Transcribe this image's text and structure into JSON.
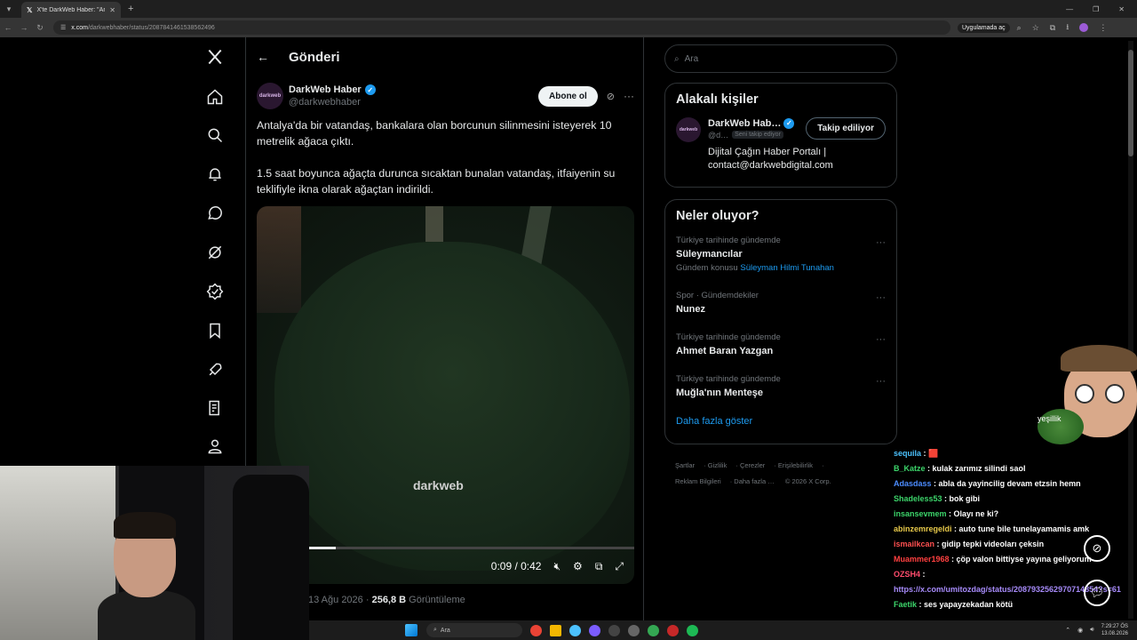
{
  "browser": {
    "tab_title": "X'te DarkWeb Haber: \"Antalya'…",
    "url_domain": "x.com",
    "url_path": "/darkwebhaber/status/2087841461538562496",
    "app_chip": "Uygulamada aç"
  },
  "post": {
    "header_title": "Gönderi",
    "author_name": "DarkWeb Haber",
    "author_handle": "@darkwebhaber",
    "avatar_text": "darkweb",
    "follow_label": "Abone ol",
    "paragraph1": "Antalya'da bir vatandaş, bankalara olan borcunun silinmesini isteyerek 10 metrelik ağaca çıktı.",
    "paragraph2": "1.5 saat boyunca ağaçta durunca sıcaktan bunalan vatandaş, itfaiyenin su teklifiyle ikna olarak ağaçtan indirildi.",
    "video": {
      "watermark": "darkweb",
      "time": "0:09 / 0:42",
      "progress": 0.21
    },
    "date": "13 Ağu 2026",
    "views_count": "256,8 B",
    "views_label": "Görüntüleme"
  },
  "sidebar": {
    "search_placeholder": "Ara",
    "related_title": "Alakalı kişiler",
    "related": {
      "name": "DarkWeb Hab…",
      "handle": "@d…",
      "follows_you": "Seni takip ediyor",
      "button": "Takip ediliyor",
      "bio": "Dijital Çağın Haber Portalı | contact@darkwebdigital.com"
    },
    "trends_title": "Neler oluyor?",
    "trends": [
      {
        "context": "Türkiye tarihinde gündemde",
        "name": "Süleymancılar",
        "sub_prefix": "Gündem konusu ",
        "sub_link": "Süleyman Hilmi Tunahan"
      },
      {
        "context": "Spor · Gündemdekiler",
        "name": "Nunez",
        "sub_prefix": "",
        "sub_link": ""
      },
      {
        "context": "Türkiye tarihinde gündemde",
        "name": "Ahmet Baran Yazgan",
        "sub_prefix": "",
        "sub_link": ""
      },
      {
        "context": "Türkiye tarihinde gündemde",
        "name": "Muğla'nın Menteşe",
        "sub_prefix": "",
        "sub_link": ""
      }
    ],
    "show_more": "Daha fazla göster",
    "footer": [
      "Şartlar",
      "Gizlilik",
      "Çerezler",
      "Erişilebilirlik",
      "Reklam Bilgileri",
      "Daha fazla …",
      "© 2026 X Corp."
    ]
  },
  "chat": {
    "mascot_label": "yeşillik",
    "messages": [
      {
        "user": "sequila",
        "text": "🟥",
        "color": "#4cc3ff"
      },
      {
        "user": "B_Katze",
        "text": "kulak zarımız silindi saol",
        "color": "#3cd46a"
      },
      {
        "user": "Adasdass",
        "text": "abla da yayincilig devam etzsin hemn",
        "color": "#4c8cff"
      },
      {
        "user": "Shadeless53",
        "text": "bok gibi",
        "color": "#3cd46a"
      },
      {
        "user": "insansevmem",
        "text": "Olayı ne ki?",
        "color": "#3cd46a"
      },
      {
        "user": "abinzemregeldi",
        "text": "auto tune bile tunelayamamis amk",
        "color": "#e6c84a"
      },
      {
        "user": "ismailkcan",
        "text": "gidip tepki videoları çeksin",
        "color": "#ff5050"
      },
      {
        "user": "Muammer1968",
        "text": "çöp valon bittiyse yayına geliyorum",
        "color": "#ff4040"
      },
      {
        "user": "OZSH4",
        "text": "",
        "color": "#ff4d6d"
      },
      {
        "user": "Faetik",
        "text": "ses yapayzekadan kötü",
        "color": "#3cd46a"
      }
    ],
    "link": "https://x.com/umitozdag/status/2087932562970714854?s=61"
  },
  "taskbar": {
    "search": "Ara",
    "time": "7:29:27 ÖS",
    "date": "13.08.2026"
  },
  "colors": {
    "accent": "#1d9bf0",
    "background": "#000000",
    "border": "#2f3336"
  }
}
